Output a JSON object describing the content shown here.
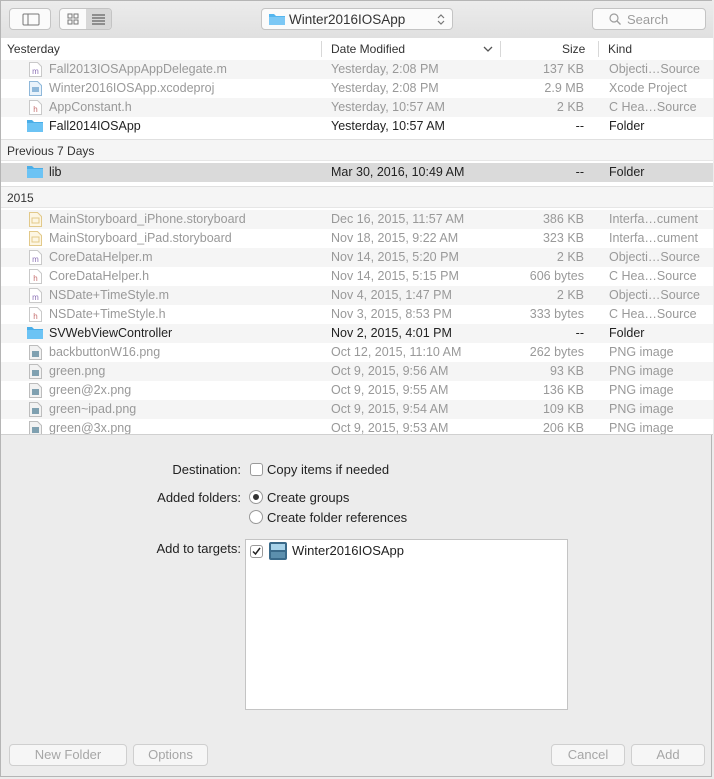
{
  "toolbar": {
    "path_label": "Winter2016IOSApp",
    "search_placeholder": "Search"
  },
  "columns": {
    "name": "Yesterday",
    "date": "Date Modified",
    "size": "Size",
    "kind": "Kind"
  },
  "sections": [
    {
      "label": "Previous 7 Days"
    },
    {
      "label": "2015"
    }
  ],
  "files": [
    {
      "name": "Fall2013IOSAppAppDelegate.m",
      "date": "Yesterday, 2:08 PM",
      "size": "137 KB",
      "kind": "Objecti…Source",
      "icon": "m-source-icon"
    },
    {
      "name": "Winter2016IOSApp.xcodeproj",
      "date": "Yesterday, 2:08 PM",
      "size": "2.9 MB",
      "kind": "Xcode Project",
      "icon": "xcodeproj-icon"
    },
    {
      "name": "AppConstant.h",
      "date": "Yesterday, 10:57 AM",
      "size": "2 KB",
      "kind": "C Hea…Source",
      "icon": "h-header-icon"
    },
    {
      "name": "Fall2014IOSApp",
      "date": "Yesterday, 10:57 AM",
      "size": "--",
      "kind": "Folder",
      "icon": "folder-icon"
    },
    {
      "name": "lib",
      "date": "Mar 30, 2016, 10:49 AM",
      "size": "--",
      "kind": "Folder",
      "icon": "folder-icon"
    },
    {
      "name": "MainStoryboard_iPhone.storyboard",
      "date": "Dec 16, 2015, 11:57 AM",
      "size": "386 KB",
      "kind": "Interfa…cument",
      "icon": "storyboard-icon"
    },
    {
      "name": "MainStoryboard_iPad.storyboard",
      "date": "Nov 18, 2015, 9:22 AM",
      "size": "323 KB",
      "kind": "Interfa…cument",
      "icon": "storyboard-icon"
    },
    {
      "name": "CoreDataHelper.m",
      "date": "Nov 14, 2015, 5:20 PM",
      "size": "2 KB",
      "kind": "Objecti…Source",
      "icon": "m-source-icon"
    },
    {
      "name": "CoreDataHelper.h",
      "date": "Nov 14, 2015, 5:15 PM",
      "size": "606 bytes",
      "kind": "C Hea…Source",
      "icon": "h-header-icon"
    },
    {
      "name": "NSDate+TimeStyle.m",
      "date": "Nov 4, 2015, 1:47 PM",
      "size": "2 KB",
      "kind": "Objecti…Source",
      "icon": "m-source-icon"
    },
    {
      "name": "NSDate+TimeStyle.h",
      "date": "Nov 3, 2015, 8:53 PM",
      "size": "333 bytes",
      "kind": "C Hea…Source",
      "icon": "h-header-icon"
    },
    {
      "name": "SVWebViewController",
      "date": "Nov 2, 2015, 4:01 PM",
      "size": "--",
      "kind": "Folder",
      "icon": "folder-icon"
    },
    {
      "name": "backbuttonW16.png",
      "date": "Oct 12, 2015, 11:10 AM",
      "size": "262 bytes",
      "kind": "PNG image",
      "icon": "png-image-icon"
    },
    {
      "name": "green.png",
      "date": "Oct 9, 2015, 9:56 AM",
      "size": "93 KB",
      "kind": "PNG image",
      "icon": "png-image-icon"
    },
    {
      "name": "green@2x.png",
      "date": "Oct 9, 2015, 9:55 AM",
      "size": "136 KB",
      "kind": "PNG image",
      "icon": "png-image-icon"
    },
    {
      "name": "green~ipad.png",
      "date": "Oct 9, 2015, 9:54 AM",
      "size": "109 KB",
      "kind": "PNG image",
      "icon": "png-image-icon"
    },
    {
      "name": "green@3x.png",
      "date": "Oct 9, 2015, 9:53 AM",
      "size": "206 KB",
      "kind": "PNG image",
      "icon": "png-image-icon"
    }
  ],
  "options": {
    "destination_label": "Destination:",
    "copy_items": "Copy items if needed",
    "copy_items_checked": false,
    "added_folders_label": "Added folders:",
    "create_groups": "Create groups",
    "create_folder_refs": "Create folder references",
    "selected_folder_option": "Create groups",
    "targets_label": "Add to targets:",
    "target_name": "Winter2016IOSApp",
    "target_checked": true
  },
  "footer": {
    "new_folder": "New Folder",
    "options": "Options",
    "cancel": "Cancel",
    "add": "Add"
  },
  "colors": {
    "folder": "#54b6ef",
    "selected_row": "#dadada",
    "dim_text": "#999999"
  }
}
